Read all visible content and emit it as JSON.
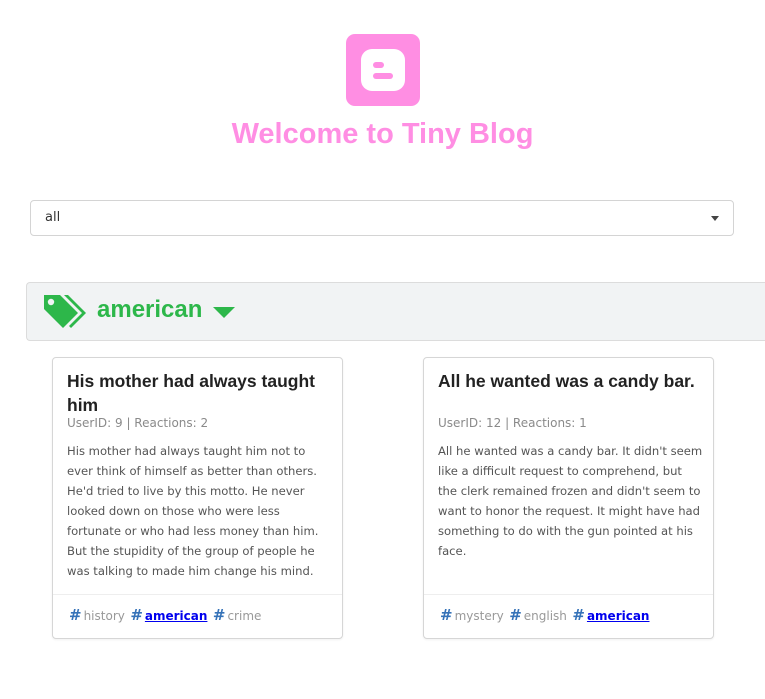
{
  "app": {
    "title": "Welcome to Tiny Blog",
    "logo_icon": "blogger-icon",
    "accent_color": "#ff8ee3"
  },
  "filter": {
    "selected": "all"
  },
  "tag_section": {
    "name": "american",
    "icon": "tags-icon",
    "color": "#2db74a"
  },
  "posts": [
    {
      "title": "His mother had always taught him",
      "meta": "UserID: 9 | Reactions: 2",
      "body": "His mother had always taught him not to ever think of himself as better than others. He'd tried to live by this motto. He never looked down on those who were less fortunate or who had less money than him. But the stupidity of the group of people he was talking to made him change his mind.",
      "tags": [
        "history",
        "american",
        "crime"
      ]
    },
    {
      "title": "All he wanted was a candy bar.",
      "meta": "UserID: 12 | Reactions: 1",
      "body": "All he wanted was a candy bar. It didn't seem like a difficult request to comprehend, but the clerk remained frozen and didn't seem to want to honor the request. It might have had something to do with the gun pointed at his face.",
      "tags": [
        "mystery",
        "english",
        "american"
      ]
    }
  ]
}
